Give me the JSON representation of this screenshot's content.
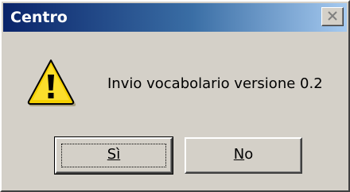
{
  "window": {
    "title": "Centro"
  },
  "dialog": {
    "icon": "warning-icon",
    "message": "Invio vocabolario versione 0.2"
  },
  "buttons": {
    "yes_label": "Sì",
    "no_label": "No"
  },
  "colors": {
    "titlebar_start": "#0a246a",
    "titlebar_end": "#a6caf0",
    "face": "#d4d0c8",
    "warning_yellow": "#f5d000"
  }
}
